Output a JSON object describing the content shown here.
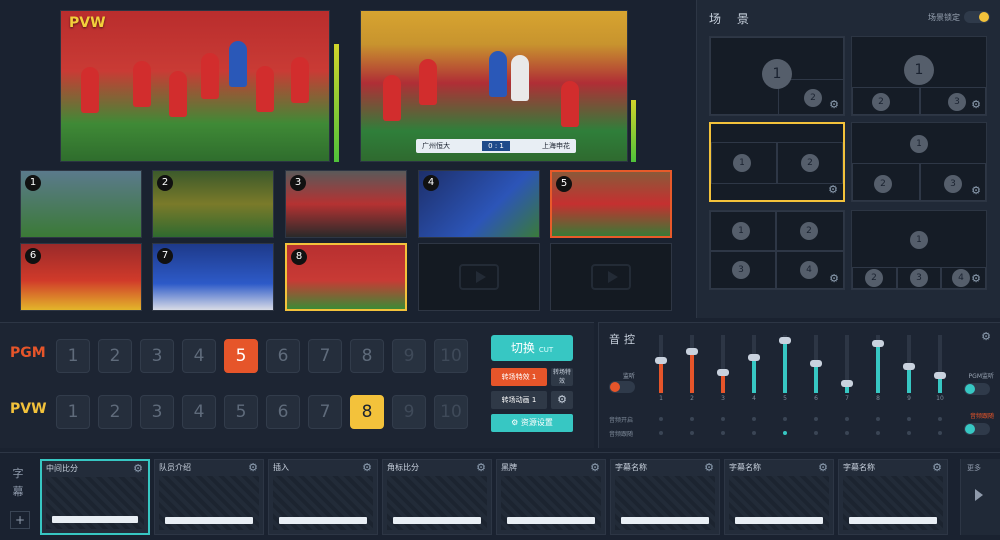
{
  "preview": {
    "label": "PVW"
  },
  "program": {
    "score_text": "0 : 1",
    "team_left": "广州恒大",
    "team_right": "上海申花"
  },
  "sources": [
    {
      "num": "1"
    },
    {
      "num": "2"
    },
    {
      "num": "3"
    },
    {
      "num": "4"
    },
    {
      "num": "5"
    },
    {
      "num": "6"
    },
    {
      "num": "7"
    },
    {
      "num": "8"
    }
  ],
  "scene": {
    "title": "场 景",
    "toggle_label": "场景锁定",
    "layouts": [
      {
        "badges": [
          "1",
          "2"
        ]
      },
      {
        "badges": [
          "1",
          "2",
          "3"
        ]
      },
      {
        "badges": [
          "1",
          "2"
        ]
      },
      {
        "badges": [
          "1",
          "2",
          "3"
        ]
      },
      {
        "badges": [
          "1",
          "2",
          "3",
          "4"
        ]
      },
      {
        "badges": [
          "1",
          "2",
          "3",
          "4"
        ]
      }
    ]
  },
  "bus": {
    "pgm_label": "PGM",
    "pvw_label": "PVW",
    "pgm_selected": "5",
    "pvw_selected": "8",
    "buttons": [
      "1",
      "2",
      "3",
      "4",
      "5",
      "6",
      "7",
      "8",
      "9",
      "10"
    ]
  },
  "transition": {
    "cut_label": "切换",
    "cut_sub": "CUT",
    "effect1": "转场特效 1",
    "side1": "转场特效",
    "effect2": "转场动画 1",
    "resource": "资源设置"
  },
  "audio": {
    "title": "音控",
    "mute_label": "监听",
    "row1_label": "音频开启",
    "row2_label": "音频跟随",
    "pgm_label": "PGM监听",
    "follow_label": "音频跟随",
    "channels": [
      "1",
      "2",
      "3",
      "4",
      "5",
      "6",
      "7",
      "8",
      "9",
      "10"
    ],
    "levels": [
      0.55,
      0.7,
      0.35,
      0.6,
      0.9,
      0.5,
      0.15,
      0.85,
      0.45,
      0.3
    ],
    "colors": [
      "#e6552a",
      "#e6552a",
      "#e6552a",
      "#37c7c3",
      "#37c7c3",
      "#37c7c3",
      "#37c7c3",
      "#37c7c3",
      "#37c7c3",
      "#37c7c3"
    ]
  },
  "captions": {
    "side_label": "字幕",
    "items": [
      {
        "title": "中间比分"
      },
      {
        "title": "队员介绍"
      },
      {
        "title": "插入"
      },
      {
        "title": "角标比分"
      },
      {
        "title": "黑牌"
      },
      {
        "title": "字幕名称"
      },
      {
        "title": "字幕名称"
      },
      {
        "title": "字幕名称"
      }
    ],
    "more_label": "更多"
  },
  "colors": {
    "pgm": "#e6552a",
    "pvw": "#f3c23b",
    "accent": "#37c7c3"
  }
}
